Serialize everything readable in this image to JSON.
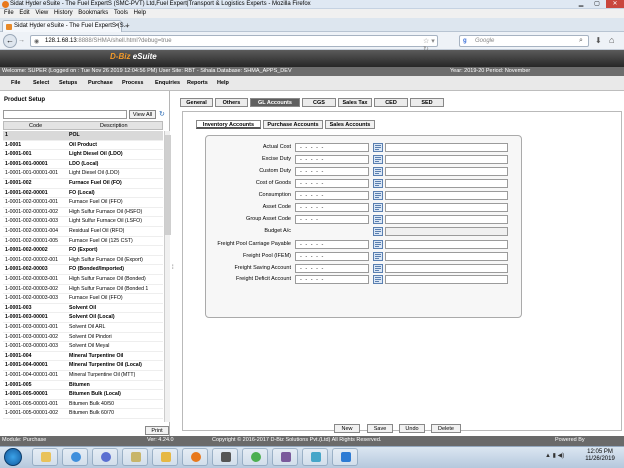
{
  "browser": {
    "window_title": "Sidat Hyder eSuite - The Fuel ExpertS (SMC-PVT) Ltd,Fuel Expert|Transport & Logistics Experts - Mozilla Firefox",
    "menu": [
      "File",
      "Edit",
      "View",
      "History",
      "Bookmarks",
      "Tools",
      "Help"
    ],
    "tab_title": "Sidat Hyder eSuite - The Fuel ExpertS (S...",
    "url_host": "128.1.68.13",
    "url_rest": ":8888/SHMA/shell.html?debug=true",
    "search_placeholder": "Google"
  },
  "app": {
    "logo": "D-Biz",
    "logo_suffix": "eSuite",
    "status_left": "Welcome: SUPER (Logged on : Tue Nov 26 2019 12:04:56 PM) User Site: RBT - Sihala Database: SHMA_APPS_DEV",
    "status_right": "Year: 2019-20 Period: November",
    "menu": [
      "File",
      "Select",
      "Setups",
      "Purchase",
      "Process",
      "Enquiries",
      "Reports",
      "Help"
    ]
  },
  "left_panel": {
    "title": "Product Setup",
    "view_all": "View All",
    "col_code": "Code",
    "col_desc": "Description",
    "print": "Print",
    "rows": [
      {
        "code": "1",
        "desc": "POL",
        "bold": true,
        "sel": true
      },
      {
        "code": "1-0001",
        "desc": "Oil Product",
        "bold": true
      },
      {
        "code": "1-0001-001",
        "desc": "Light Diesel Oil (LDO)",
        "bold": true
      },
      {
        "code": "1-0001-001-00001",
        "desc": "LDO (Local)",
        "bold": true
      },
      {
        "code": "1-0001-001-00001-001",
        "desc": "Light Diesel Oil (LDO)",
        "bold": false
      },
      {
        "code": "1-0001-002",
        "desc": "Furnace Fuel Oil (FO)",
        "bold": true
      },
      {
        "code": "1-0001-002-00001",
        "desc": "FO (Local)",
        "bold": true
      },
      {
        "code": "1-0001-002-00001-001",
        "desc": "Furnace Fuel Oil (FFO)",
        "bold": false
      },
      {
        "code": "1-0001-002-00001-002",
        "desc": "High Sulfur Furnace Oil (HSFO)",
        "bold": false
      },
      {
        "code": "1-0001-002-00001-003",
        "desc": "Light Sulfur Furnace Oil (LSFO)",
        "bold": false
      },
      {
        "code": "1-0001-002-00001-004",
        "desc": "Residual Fuel Oil (RFO)",
        "bold": false
      },
      {
        "code": "1-0001-002-00001-005",
        "desc": "Furnace Fuel Oil (125 CST)",
        "bold": false
      },
      {
        "code": "1-0001-002-00002",
        "desc": "FO (Export)",
        "bold": true
      },
      {
        "code": "1-0001-002-00002-001",
        "desc": "High Sulfur Furnace Oil (Export)",
        "bold": false
      },
      {
        "code": "1-0001-002-00003",
        "desc": "FO (Bonded/Imported)",
        "bold": true
      },
      {
        "code": "1-0001-002-00003-001",
        "desc": "High Sulfur Furnace Oil (Bonded)",
        "bold": false
      },
      {
        "code": "1-0001-002-00003-002",
        "desc": "High Sulfur Furnace Oil (Bonded 1",
        "bold": false
      },
      {
        "code": "1-0001-002-00003-003",
        "desc": "Furnace Fuel Oil (FFO)",
        "bold": false
      },
      {
        "code": "1-0001-003",
        "desc": "Solvent Oil",
        "bold": true
      },
      {
        "code": "1-0001-003-00001",
        "desc": "Solvent Oil (Local)",
        "bold": true
      },
      {
        "code": "1-0001-003-00001-001",
        "desc": "Solvent Oil ARL",
        "bold": false
      },
      {
        "code": "1-0001-003-00001-002",
        "desc": "Solvent Oil Pindori",
        "bold": false
      },
      {
        "code": "1-0001-003-00001-003",
        "desc": "Solvent Oil Meyal",
        "bold": false
      },
      {
        "code": "1-0001-004",
        "desc": "Mineral Turpentine Oil",
        "bold": true
      },
      {
        "code": "1-0001-004-00001",
        "desc": "Mineral Turpentine Oil (Local)",
        "bold": true
      },
      {
        "code": "1-0001-004-00001-001",
        "desc": "Mineral Turpentine Oil (MTT)",
        "bold": false
      },
      {
        "code": "1-0001-005",
        "desc": "Bitumen",
        "bold": true
      },
      {
        "code": "1-0001-005-00001",
        "desc": "Bitumen Bulk (Local)",
        "bold": true
      },
      {
        "code": "1-0001-005-00001-001",
        "desc": "Bitumen Bulk 40/50",
        "bold": false
      },
      {
        "code": "1-0001-005-00001-002",
        "desc": "Bitumen Bulk 60/70",
        "bold": false
      }
    ]
  },
  "main_tabs": [
    {
      "label": "General",
      "active": false
    },
    {
      "label": "Others",
      "active": false
    },
    {
      "label": "GL Accounts",
      "active": true
    },
    {
      "label": "CGS",
      "active": false
    },
    {
      "label": "Sales Tax",
      "active": false
    },
    {
      "label": "CED",
      "active": false
    },
    {
      "label": "SED",
      "active": false
    }
  ],
  "sub_tabs": [
    {
      "label": "Inventory Accounts",
      "active": true
    },
    {
      "label": "Purchase Accounts",
      "active": false
    },
    {
      "label": "Sales Accounts",
      "active": false
    }
  ],
  "fields": [
    {
      "label": "Actual Cost",
      "mask": "- - - -  -",
      "disabled": false
    },
    {
      "label": "Excise Duty",
      "mask": "- - - -  -",
      "disabled": false
    },
    {
      "label": "Custom Duty",
      "mask": "- - - -  -",
      "disabled": false
    },
    {
      "label": "Cost of Goods",
      "mask": "- - - -  -",
      "disabled": false
    },
    {
      "label": "Consumption",
      "mask": "- - - -  -",
      "disabled": false
    },
    {
      "label": "Asset Code",
      "mask": "- - - -  -",
      "disabled": false
    },
    {
      "label": "Group Asset Code",
      "mask": "- - - -",
      "disabled": false
    },
    {
      "label": "Budget A/c",
      "mask": "",
      "disabled": true
    },
    {
      "label": "Freight Pool Carriage Payable",
      "mask": "- - - -  -",
      "disabled": false
    },
    {
      "label": "Freight Pool (IFEM)",
      "mask": "- - - -  -",
      "disabled": false
    },
    {
      "label": "Freight Saving Account",
      "mask": "- - - -  -",
      "disabled": false
    },
    {
      "label": "Freight Deficit Account",
      "mask": "- - - -  -",
      "disabled": false
    }
  ],
  "actions": [
    "New",
    "Save",
    "Undo",
    "Delete"
  ],
  "footer": {
    "module": "Module: Purchase",
    "version": "Ver: 4.24.0",
    "copyright": "Copyright © 2016-2017 D-Biz Solutions Pvt.(Ltd) All Rights Reserved.",
    "powered": "Powered By"
  },
  "taskbar": {
    "time": "12:05 PM",
    "date": "11/26/2019"
  }
}
